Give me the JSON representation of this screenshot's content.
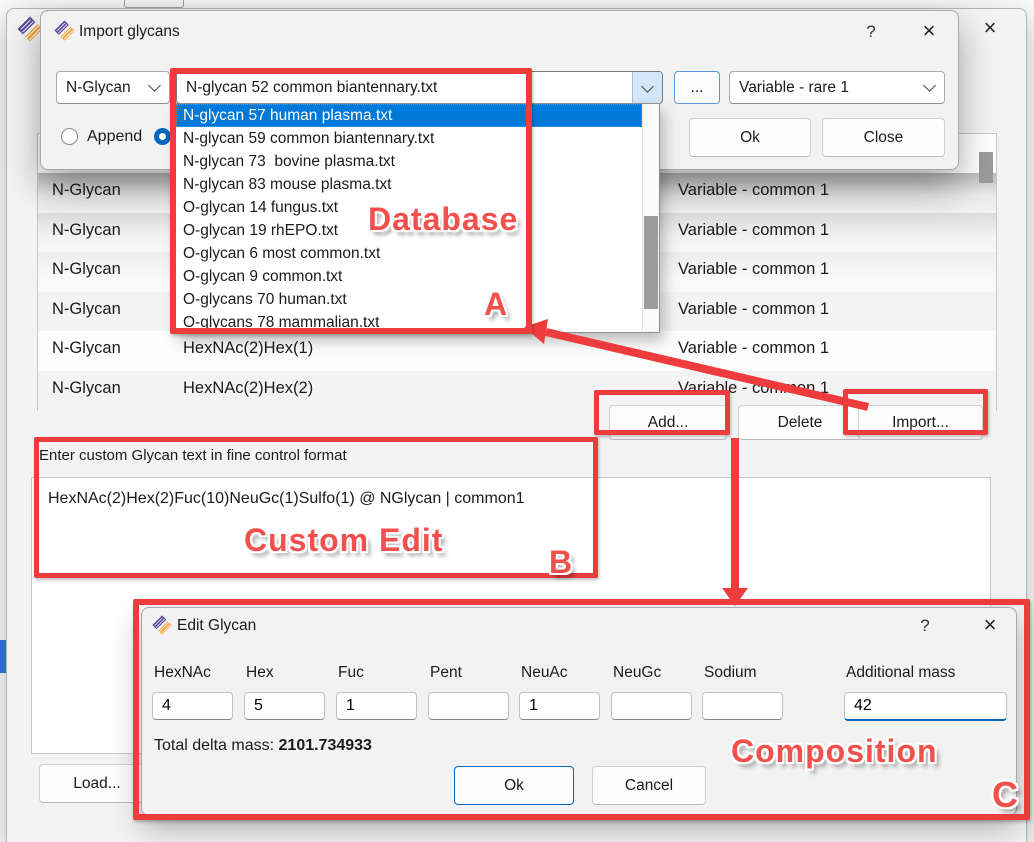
{
  "annotation": {
    "color": "#ee3b3b",
    "database_label": "Database",
    "a_label": "A",
    "custom_edit_label": "Custom Edit",
    "b_label": "B",
    "composition_label": "Composition",
    "c_label": "C"
  },
  "main_window": {
    "close_icon": "×",
    "table": {
      "rows": [
        {
          "type": "N-Glycan",
          "composition": "",
          "modification": "Variable - common 1"
        },
        {
          "type": "N-Glycan",
          "composition": "",
          "modification": "Variable - common 1"
        },
        {
          "type": "N-Glycan",
          "composition": "",
          "modification": "Variable - common 1"
        },
        {
          "type": "N-Glycan",
          "composition": "",
          "modification": "Variable - common 1"
        },
        {
          "type": "N-Glycan",
          "composition": "HexNAc(2)Hex(1)",
          "modification": "Variable - common 1"
        },
        {
          "type": "N-Glycan",
          "composition": "HexNAc(2)Hex(2)",
          "modification": "Variable - common 1"
        }
      ]
    },
    "add_button": "Add...",
    "delete_button": "Delete",
    "import_button": "Import...",
    "load_button": "Load...",
    "custom_label": "Enter custom Glycan text in fine control format",
    "custom_text": "HexNAc(2)Hex(2)Fuc(10)NeuGc(1)Sulfo(1) @ NGlycan | common1"
  },
  "import_dialog": {
    "title": "Import glycans",
    "help_icon": "?",
    "close_icon": "×",
    "type_combo": "N-Glycan",
    "file_combo": "N-glycan 52 common biantennary.txt",
    "browse_button": "...",
    "mod_combo": "Variable - rare 1",
    "append_label": "Append",
    "ok_button": "Ok",
    "close_button": "Close",
    "dropdown_items": [
      "N-glycan 57 human plasma.txt",
      "N-glycan 59 common biantennary.txt",
      "N-glycan 73  bovine plasma.txt",
      "N-glycan 83 mouse plasma.txt",
      "O-glycan 14 fungus.txt",
      "O-glycan 19 rhEPO.txt",
      "O-glycan 6 most common.txt",
      "O-glycan 9 common.txt",
      "O-glycans 70 human.txt",
      "O-glycans 78 mammalian.txt"
    ]
  },
  "edit_dialog": {
    "title": "Edit Glycan",
    "help_icon": "?",
    "close_icon": "×",
    "fields": [
      {
        "label": "HexNAc",
        "value": "4"
      },
      {
        "label": "Hex",
        "value": "5"
      },
      {
        "label": "Fuc",
        "value": "1"
      },
      {
        "label": "Pent",
        "value": ""
      },
      {
        "label": "NeuAc",
        "value": "1"
      },
      {
        "label": "NeuGc",
        "value": ""
      },
      {
        "label": "Sodium",
        "value": ""
      },
      {
        "label": "Additional mass",
        "value": "42"
      }
    ],
    "total_label": "Total delta mass:",
    "total_value": "2101.734933",
    "ok_button": "Ok",
    "cancel_button": "Cancel"
  }
}
